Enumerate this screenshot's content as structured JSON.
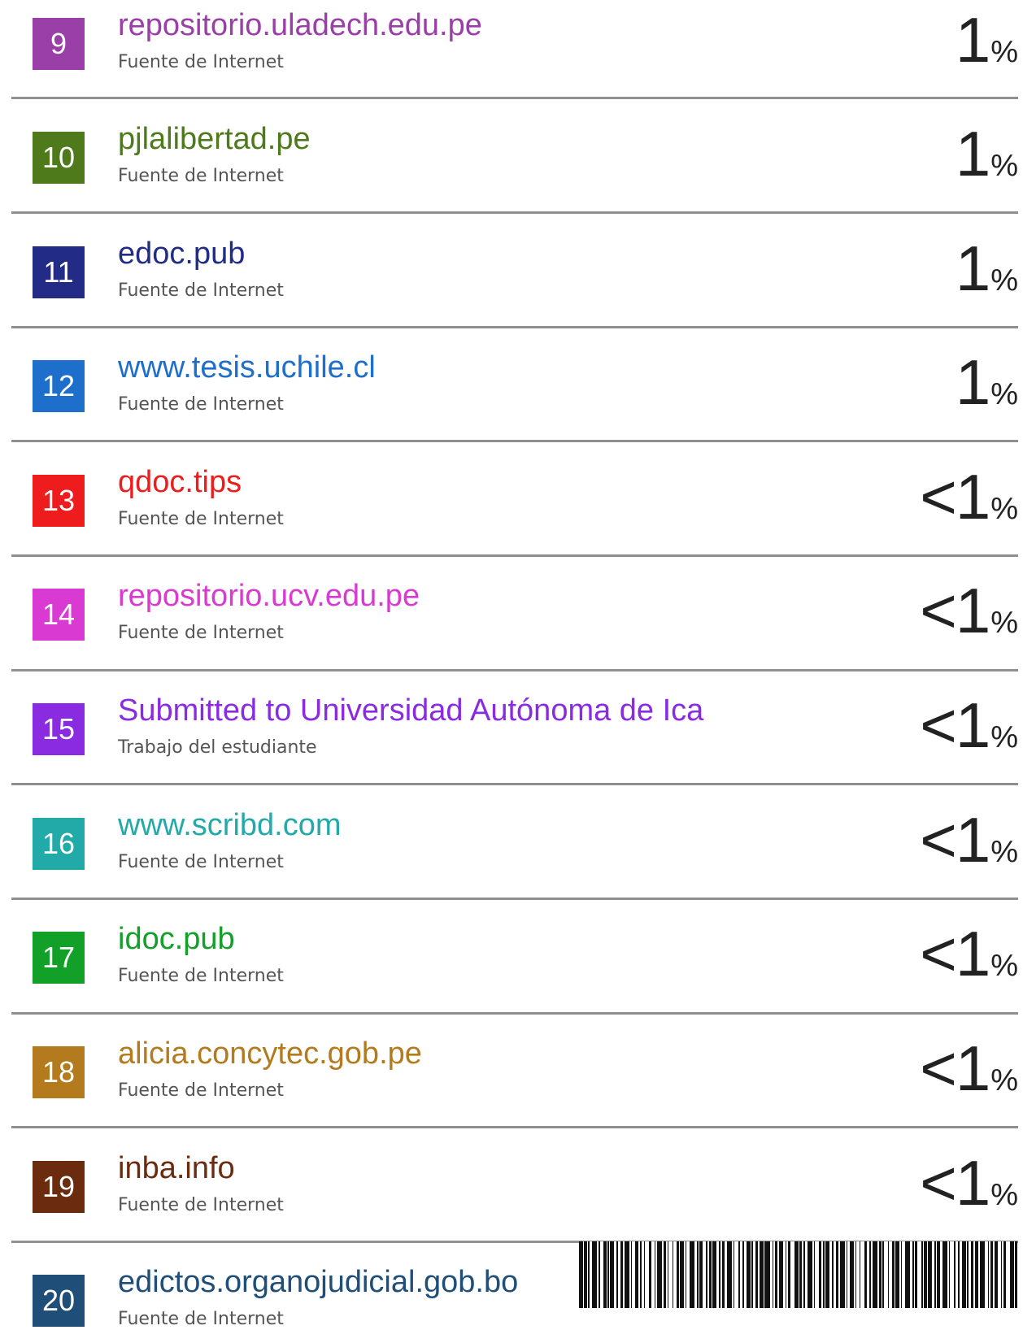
{
  "sources": [
    {
      "n": "9",
      "name": "repositorio.uladech.edu.pe",
      "type": "Fuente de Internet",
      "pct": "1",
      "color": "#9b3fa8",
      "name_color": "#9b3fa8"
    },
    {
      "n": "10",
      "name": "pjlalibertad.pe",
      "type": "Fuente de Internet",
      "pct": "1",
      "color": "#4e7a1c",
      "name_color": "#4e7a1c"
    },
    {
      "n": "11",
      "name": "edoc.pub",
      "type": "Fuente de Internet",
      "pct": "1",
      "color": "#222b86",
      "name_color": "#222b86"
    },
    {
      "n": "12",
      "name": "www.tesis.uchile.cl",
      "type": "Fuente de Internet",
      "pct": "1",
      "color": "#1e6fcc",
      "name_color": "#1e6fcc"
    },
    {
      "n": "13",
      "name": "qdoc.tips",
      "type": "Fuente de Internet",
      "pct": "<1",
      "color": "#ee1c1c",
      "name_color": "#ee1c1c"
    },
    {
      "n": "14",
      "name": "repositorio.ucv.edu.pe",
      "type": "Fuente de Internet",
      "pct": "<1",
      "color": "#d93ad2",
      "name_color": "#d93ad2"
    },
    {
      "n": "15",
      "name": "Submitted to Universidad Autónoma de Ica",
      "type": "Trabajo del estudiante",
      "pct": "<1",
      "color": "#8a2be2",
      "name_color": "#8a2be2"
    },
    {
      "n": "16",
      "name": "www.scribd.com",
      "type": "Fuente de Internet",
      "pct": "<1",
      "color": "#22aaa8",
      "name_color": "#22aaa8"
    },
    {
      "n": "17",
      "name": "idoc.pub",
      "type": "Fuente de Internet",
      "pct": "<1",
      "color": "#12a028",
      "name_color": "#12a028"
    },
    {
      "n": "18",
      "name": "alicia.concytec.gob.pe",
      "type": "Fuente de Internet",
      "pct": "<1",
      "color": "#b37a1e",
      "name_color": "#b37a1e"
    },
    {
      "n": "19",
      "name": "inba.info",
      "type": "Fuente de Internet",
      "pct": "<1",
      "color": "#6b2b0e",
      "name_color": "#6b2b0e"
    },
    {
      "n": "20",
      "name": "edictos.organojudicial.gob.bo",
      "type": "Fuente de Internet",
      "pct": "",
      "color": "#1f4e79",
      "name_color": "#1f4e79"
    }
  ],
  "percent_sign": "%"
}
